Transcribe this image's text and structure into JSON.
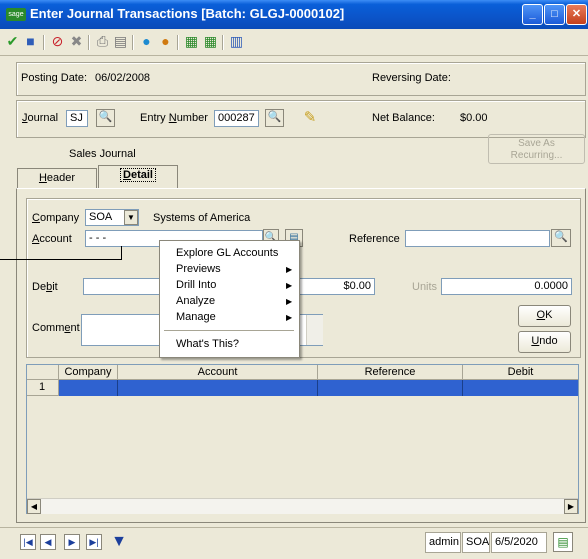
{
  "window": {
    "title": "Enter Journal Transactions [Batch: GLGJ-0000102]",
    "app_icon": "sage"
  },
  "header": {
    "posting_date_label": "Posting Date:",
    "posting_date": "06/02/2008",
    "reversing_date_label": "Reversing Date:",
    "journal_label": "Journal",
    "journal_value": "SJ",
    "entry_number_label": "Entry Number",
    "entry_number_value": "000287",
    "net_balance_label": "Net Balance:",
    "net_balance_value": "$0.00",
    "journal_desc": "Sales Journal",
    "save_as_recurring_line1": "Save As",
    "save_as_recurring_line2": "Recurring..."
  },
  "tabs": [
    {
      "label": "Header"
    },
    {
      "label": "Detail"
    }
  ],
  "detail": {
    "company_label": "Company",
    "company_value": "SOA",
    "company_desc": "Systems of America",
    "account_label": "Account",
    "account_value": "- - -",
    "reference_label": "Reference",
    "debit_label": "Debit",
    "credit_value": "$0.00",
    "units_label": "Units",
    "units_value": "0.0000",
    "comment_label": "Comment",
    "ok_label": "OK",
    "undo_label": "Undo"
  },
  "context_menu": {
    "items": [
      "Explore GL Accounts",
      "Previews",
      "Drill Into",
      "Analyze",
      "Manage",
      "What's This?"
    ]
  },
  "grid": {
    "columns": [
      "Company",
      "Account",
      "Reference",
      "Debit"
    ],
    "rows": [
      {
        "num": "1"
      }
    ]
  },
  "status": {
    "user": "admin",
    "company": "SOA",
    "date": "6/5/2020"
  },
  "colors": {
    "titlebar": "#0a55c9",
    "selection": "#2f62d0",
    "window_bg": "#ece9d8"
  }
}
